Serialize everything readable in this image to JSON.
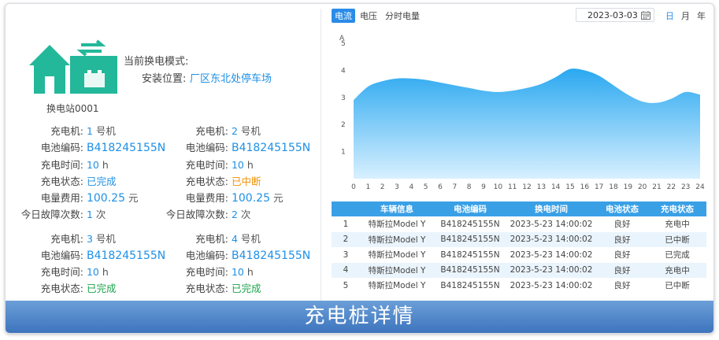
{
  "station": {
    "mode_label": "当前换电模式:",
    "location_label": "安装位置:",
    "location_value": "厂区东北处停车场",
    "name": "换电站0001"
  },
  "chargers": [
    {
      "charger_label": "充电机:",
      "charger_num": "1",
      "charger_unit": "号机",
      "battery_label": "电池编码:",
      "battery": "B418245155N",
      "time_label": "充电时间:",
      "time": "10",
      "time_unit": "h",
      "status_label": "充电状态:",
      "status": "已完成",
      "fee_label": "电量费用:",
      "fee": "100.25",
      "fee_unit": "元",
      "fault_label": "今日故障次数:",
      "fault": "1",
      "fault_unit": "次"
    },
    {
      "charger_label": "充电机:",
      "charger_num": "2",
      "charger_unit": "号机",
      "battery_label": "电池编码:",
      "battery": "B418245155N",
      "time_label": "充电时间:",
      "time": "10",
      "time_unit": "h",
      "status_label": "充电状态:",
      "status": "已中断",
      "fee_label": "电量费用:",
      "fee": "100.25",
      "fee_unit": "元",
      "fault_label": "今日故障次数:",
      "fault": "2",
      "fault_unit": "次"
    },
    {
      "charger_label": "充电机:",
      "charger_num": "3",
      "charger_unit": "号机",
      "battery_label": "电池编码:",
      "battery": "B418245155N",
      "time_label": "充电时间:",
      "time": "10",
      "time_unit": "h",
      "status_label": "充电状态:",
      "status": "已完成"
    },
    {
      "charger_label": "充电机:",
      "charger_num": "4",
      "charger_unit": "号机",
      "battery_label": "电池编码:",
      "battery": "B418245155N",
      "time_label": "充电时间:",
      "time": "10",
      "time_unit": "h",
      "status_label": "充电状态:",
      "status": "已完成"
    }
  ],
  "tabs": [
    "电流",
    "电压",
    "分时电量"
  ],
  "date": "2023-03-03",
  "periods": [
    "日",
    "月",
    "年"
  ],
  "chart_data": {
    "type": "area",
    "ylabel": "A",
    "x": [
      0,
      1,
      2,
      3,
      4,
      5,
      6,
      7,
      8,
      9,
      10,
      11,
      12,
      13,
      14,
      15,
      16,
      17,
      18,
      19,
      20,
      21,
      22,
      23,
      24
    ],
    "y": [
      2.9,
      3.4,
      3.6,
      3.7,
      3.7,
      3.65,
      3.55,
      3.45,
      3.35,
      3.25,
      3.2,
      3.25,
      3.35,
      3.5,
      3.75,
      4.05,
      4.0,
      3.8,
      3.45,
      3.1,
      2.85,
      2.8,
      2.95,
      3.2,
      3.1
    ],
    "ylim": [
      0,
      5
    ],
    "yticks": [
      1,
      2,
      3,
      4,
      5
    ],
    "color": "#35aef0"
  },
  "table": {
    "headers": [
      "",
      "车辆信息",
      "电池编码",
      "换电时间",
      "电池状态",
      "充电状态"
    ],
    "rows": [
      {
        "idx": "1",
        "vehicle": "特斯拉Model Y",
        "battery": "B418245155N",
        "time": "2023-5-23 14:00:02",
        "bstate": "良好",
        "cstate": "充电中",
        "ccolor": "green"
      },
      {
        "idx": "2",
        "vehicle": "特斯拉Model Y",
        "battery": "B418245155N",
        "time": "2023-5-23 14:00:02",
        "bstate": "良好",
        "cstate": "已中断",
        "ccolor": "orange"
      },
      {
        "idx": "3",
        "vehicle": "特斯拉Model Y",
        "battery": "B418245155N",
        "time": "2023-5-23 14:00:02",
        "bstate": "良好",
        "cstate": "已完成",
        "ccolor": "blue"
      },
      {
        "idx": "4",
        "vehicle": "特斯拉Model Y",
        "battery": "B418245155N",
        "time": "2023-5-23 14:00:02",
        "bstate": "良好",
        "cstate": "充电中",
        "ccolor": "green"
      },
      {
        "idx": "5",
        "vehicle": "特斯拉Model Y",
        "battery": "B418245155N",
        "time": "2023-5-23 14:00:02",
        "bstate": "良好",
        "cstate": "已中断",
        "ccolor": "orange"
      }
    ]
  },
  "banner": "充电桩详情"
}
